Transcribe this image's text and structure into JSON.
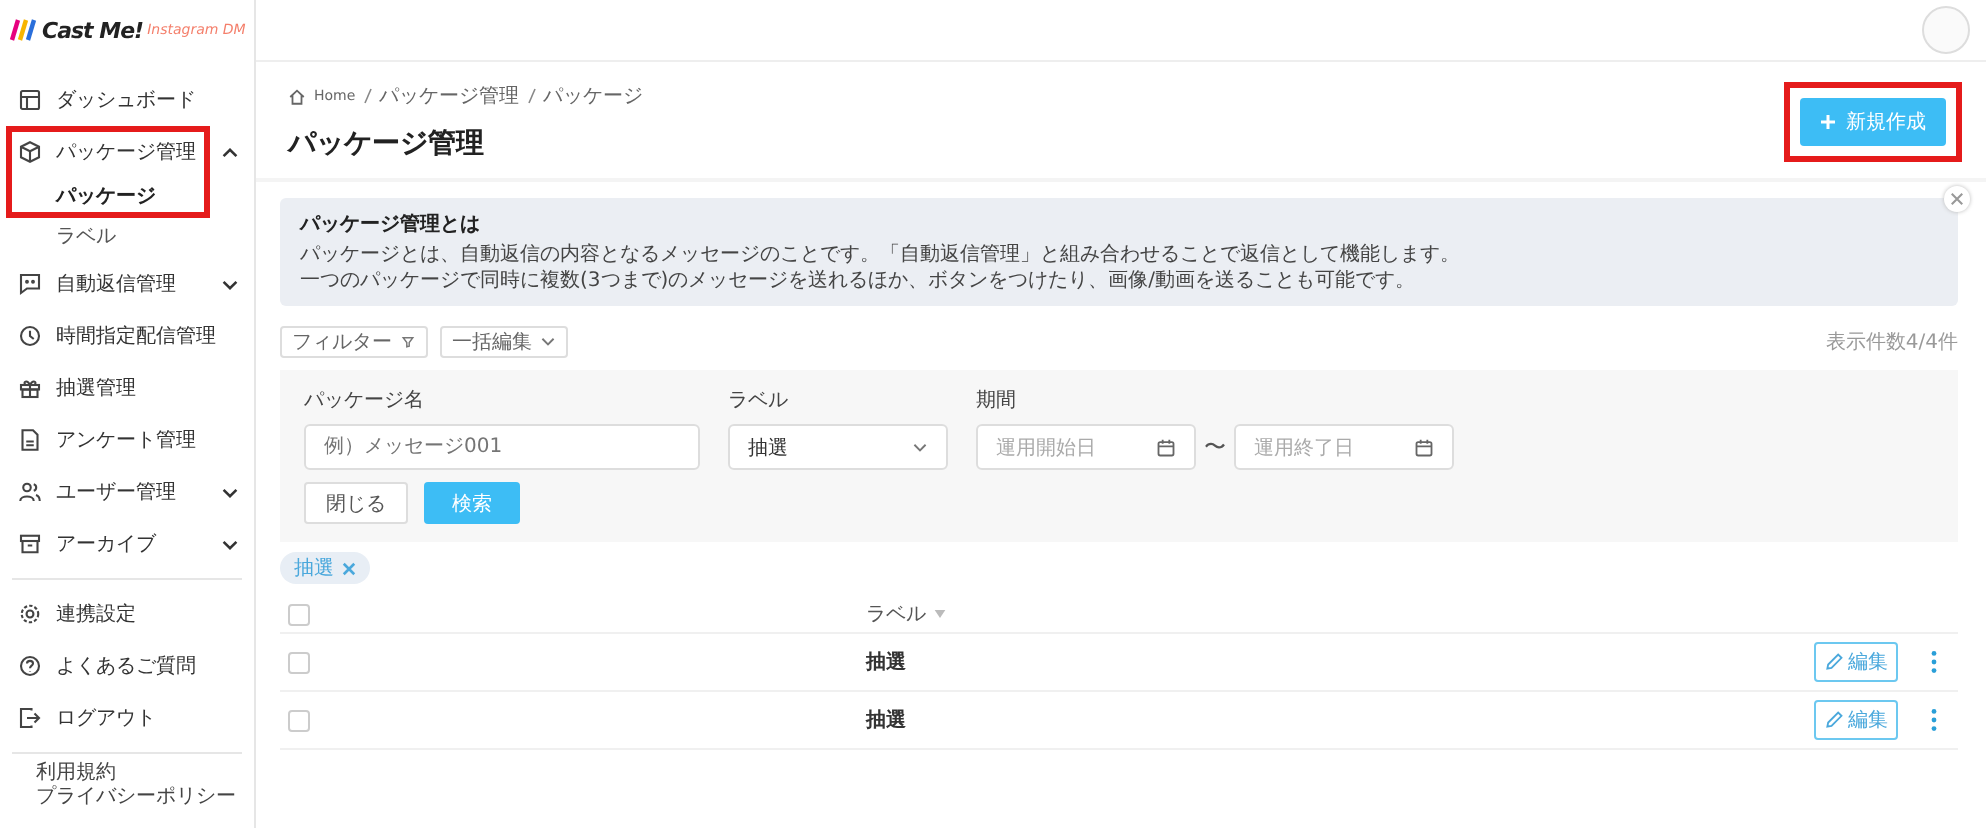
{
  "logo": {
    "brand": "Cast Me!",
    "product": "Instagram DM"
  },
  "sidebar": {
    "main_items": [
      {
        "label": "ダッシュボード"
      },
      {
        "label": "パッケージ管理",
        "expanded": true,
        "highlighted": true,
        "children": [
          {
            "label": "パッケージ",
            "selected": true
          },
          {
            "label": "ラベル",
            "selected": false
          }
        ]
      },
      {
        "label": "自動返信管理",
        "expanded": false
      },
      {
        "label": "時間指定配信管理"
      },
      {
        "label": "抽選管理"
      },
      {
        "label": "アンケート管理"
      },
      {
        "label": "ユーザー管理",
        "expanded": false
      },
      {
        "label": "アーカイブ",
        "expanded": false
      }
    ],
    "settings_items": [
      {
        "label": "連携設定"
      },
      {
        "label": "よくあるご質問"
      },
      {
        "label": "ログアウト"
      }
    ],
    "footer_links": [
      "利用規約",
      "プライバシーポリシー"
    ]
  },
  "breadcrumb": [
    "Home",
    "パッケージ管理",
    "パッケージ"
  ],
  "page_title": "パッケージ管理",
  "create_button": {
    "label": "新規作成",
    "highlighted": true
  },
  "info_box": {
    "title": "パッケージ管理とは",
    "lines": [
      "パッケージとは、自動返信の内容となるメッセージのことです。「自動返信管理」と組み合わせることで返信として機能します。",
      "一つのパッケージで同時に複数(3つまで)のメッセージを送れるほか、ボタンをつけたり、画像/動画を送ることも可能です。"
    ]
  },
  "toolbar": {
    "filter_button": "フィルター",
    "bulk_edit_button": "一括編集",
    "count": "表示件数4/4件"
  },
  "filter_panel": {
    "name_label": "パッケージ名",
    "name_placeholder": "例）メッセージ001",
    "label_label": "ラベル",
    "label_value": "抽選",
    "period_label": "期間",
    "start_placeholder": "運用開始日",
    "separator": "〜",
    "end_placeholder": "運用終了日",
    "close_button": "閉じる",
    "search_button": "検索"
  },
  "active_tags": [
    "抽選"
  ],
  "table": {
    "column_2": "ラベル",
    "header_checked": false,
    "rows": [
      {
        "checked": false,
        "label": "抽選",
        "edit_button": "編集"
      },
      {
        "checked": false,
        "label": "抽選",
        "edit_button": "編集"
      }
    ]
  }
}
